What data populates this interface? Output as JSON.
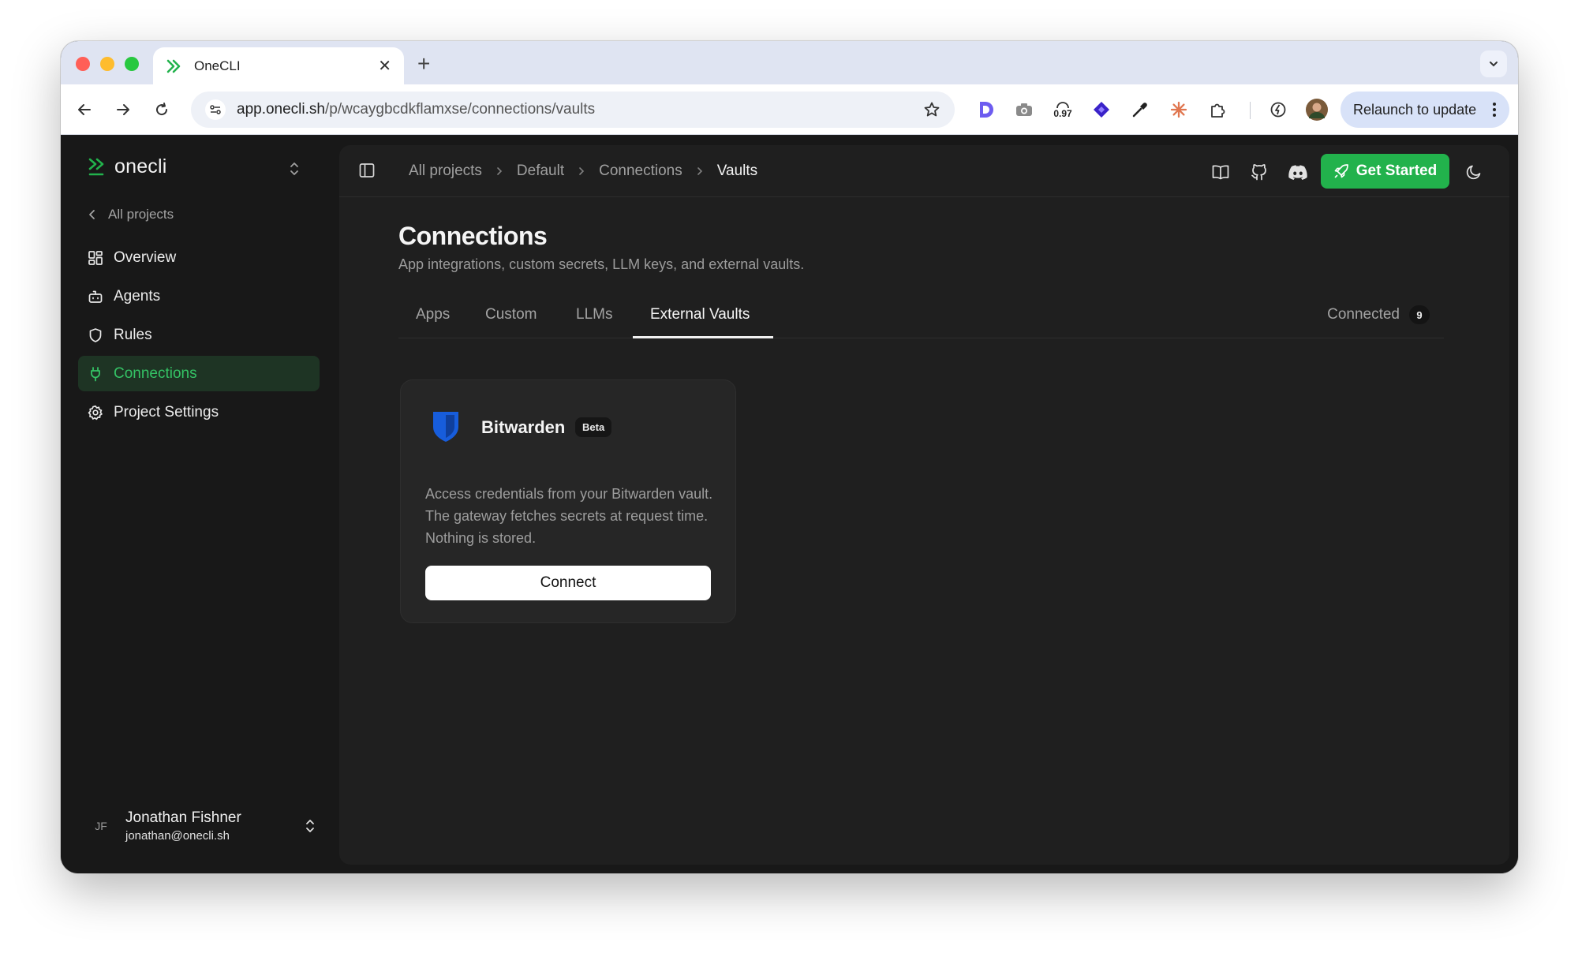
{
  "browser": {
    "tab_title": "OneCLI",
    "url_host": "app.onecli.sh",
    "url_path": "/p/wcaygbcdkflamxse/connections/vaults",
    "extension_badge": "0.97",
    "relaunch_label": "Relaunch to update"
  },
  "sidebar": {
    "brand": "onecli",
    "back_label": "All projects",
    "items": [
      {
        "label": "Overview",
        "icon": "grid-icon"
      },
      {
        "label": "Agents",
        "icon": "bot-icon"
      },
      {
        "label": "Rules",
        "icon": "shield-icon"
      },
      {
        "label": "Connections",
        "icon": "plug-icon",
        "active": true
      },
      {
        "label": "Project Settings",
        "icon": "gear-icon"
      }
    ],
    "user": {
      "initials": "JF",
      "name": "Jonathan Fishner",
      "email": "jonathan@onecli.sh"
    }
  },
  "topbar": {
    "breadcrumbs": [
      "All projects",
      "Default",
      "Connections",
      "Vaults"
    ],
    "get_started_label": "Get Started"
  },
  "page": {
    "title": "Connections",
    "subtitle": "App integrations, custom secrets, LLM keys, and external vaults.",
    "tabs": [
      "Apps",
      "Custom",
      "LLMs",
      "External Vaults"
    ],
    "active_tab": "External Vaults",
    "connected_label": "Connected",
    "connected_count": "9"
  },
  "card": {
    "name": "Bitwarden",
    "badge": "Beta",
    "description": "Access credentials from your Bitwarden vault. The gateway fetches secrets at request time. Nothing is stored.",
    "button_label": "Connect"
  },
  "colors": {
    "accent_green": "#22b24c",
    "active_nav_text": "#34c265",
    "bitwarden_blue": "#175ddc"
  }
}
